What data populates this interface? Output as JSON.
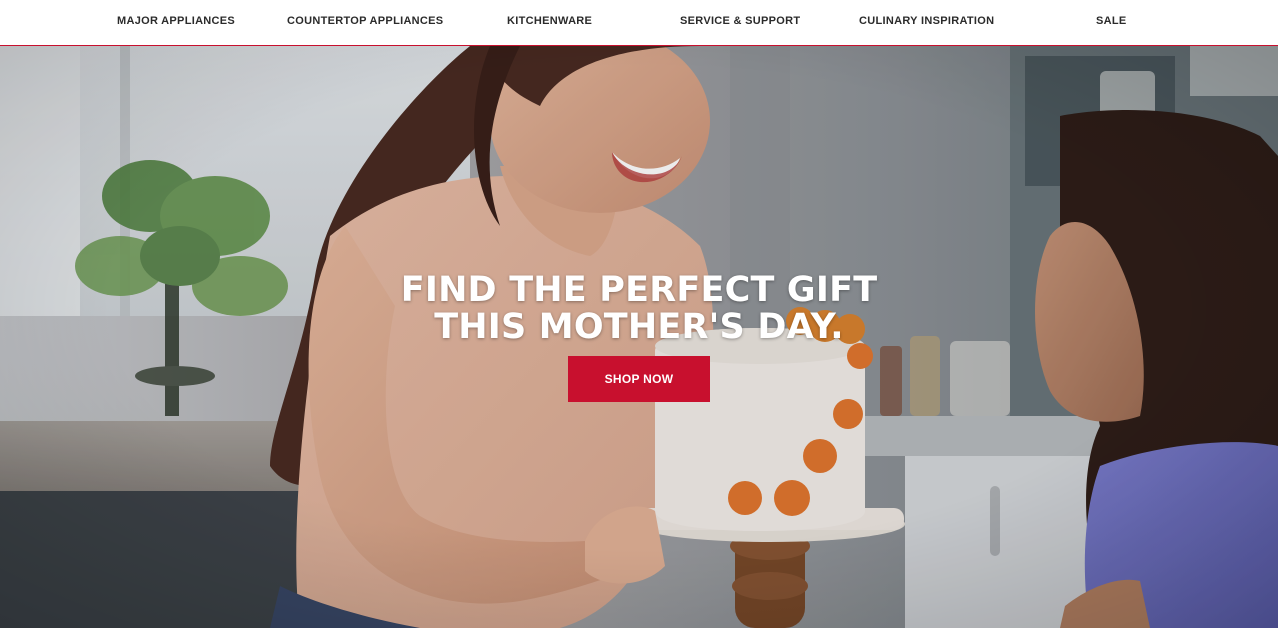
{
  "nav": {
    "items": [
      {
        "label": "MAJOR APPLIANCES"
      },
      {
        "label": "COUNTERTOP APPLIANCES"
      },
      {
        "label": "KITCHENWARE"
      },
      {
        "label": "SERVICE & SUPPORT"
      },
      {
        "label": "CULINARY INSPIRATION"
      },
      {
        "label": "SALE"
      }
    ]
  },
  "hero": {
    "headline": "FIND THE PERFECT GIFT THIS MOTHER'S DAY.",
    "cta_label": "SHOP NOW"
  },
  "colors": {
    "accent": "#c8102e",
    "nav_text": "#2b2b2b",
    "hero_text": "#ffffff"
  }
}
